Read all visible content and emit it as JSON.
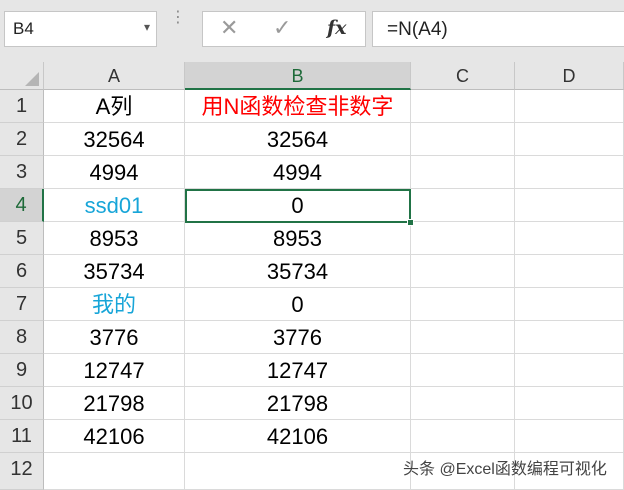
{
  "formula_bar": {
    "name_box": "B4",
    "name_box_arrow": "▾",
    "separator": "⋮",
    "cancel_icon": "✕",
    "enter_icon": "✓",
    "function_icon": "fx",
    "formula": "=N(A4)"
  },
  "grid": {
    "select_all": "select-all-corner",
    "columns": [
      "A",
      "B",
      "C",
      "D"
    ],
    "selected_column": "B",
    "selected_row": "4",
    "active_cell": "B4",
    "rows": [
      {
        "num": "1",
        "a": "A列",
        "b": "用N函数检查非数字"
      },
      {
        "num": "2",
        "a": "32564",
        "b": "32564"
      },
      {
        "num": "3",
        "a": "4994",
        "b": "4994"
      },
      {
        "num": "4",
        "a": "ssd01",
        "b": "0"
      },
      {
        "num": "5",
        "a": "8953",
        "b": "8953"
      },
      {
        "num": "6",
        "a": "35734",
        "b": "35734"
      },
      {
        "num": "7",
        "a": "我的",
        "b": "0"
      },
      {
        "num": "8",
        "a": "3776",
        "b": "3776"
      },
      {
        "num": "9",
        "a": "12747",
        "b": "12747"
      },
      {
        "num": "10",
        "a": "21798",
        "b": "21798"
      },
      {
        "num": "11",
        "a": "42106",
        "b": "42106"
      },
      {
        "num": "12",
        "a": "",
        "b": ""
      }
    ]
  },
  "colors": {
    "header_red": "#ff0000",
    "text_value_blue": "#17a5d8",
    "selection_green": "#217346"
  },
  "watermark": "头条 @Excel函数编程可视化"
}
